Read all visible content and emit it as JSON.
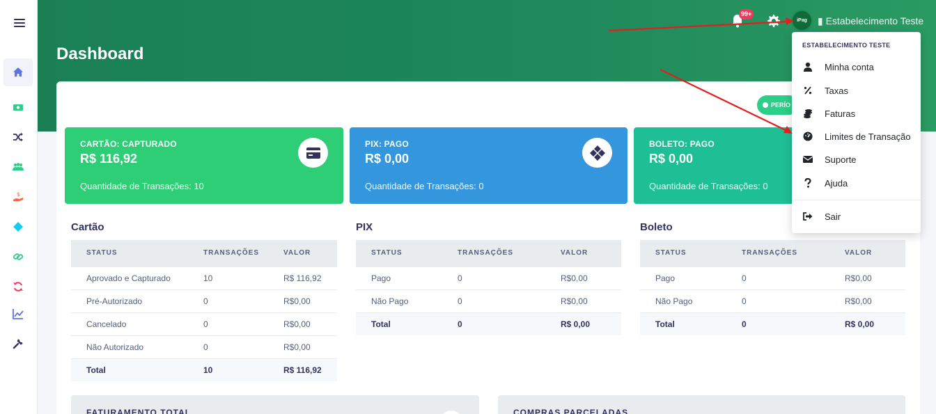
{
  "header": {
    "title": "Dashboard",
    "notification_badge": "99+",
    "avatar_text": "iPag",
    "store_name": "Estabelecimento Teste",
    "period_label": "PERÍO"
  },
  "sidebar": {
    "items": [
      {
        "icon": "home-icon",
        "color": "#5e72e4"
      },
      {
        "icon": "money-icon",
        "color": "#2dce89"
      },
      {
        "icon": "shuffle-icon",
        "color": "#32325d"
      },
      {
        "icon": "users-icon",
        "color": "#2dce89"
      },
      {
        "icon": "hand-dollar-icon",
        "color": "#fb6340"
      },
      {
        "icon": "pix-icon",
        "color": "#11cdef"
      },
      {
        "icon": "link-icon",
        "color": "#2dce89"
      },
      {
        "icon": "refresh-icon",
        "color": "#f5365c"
      },
      {
        "icon": "chart-line-icon",
        "color": "#5e72e4"
      },
      {
        "icon": "wrench-icon",
        "color": "#32325d"
      }
    ]
  },
  "stats": {
    "card": {
      "label": "CARTÃO: CAPTURADO",
      "value": "R$ 116,92",
      "count": "Quantidade de Transações: 10"
    },
    "pix": {
      "label": "PIX: PAGO",
      "value": "R$ 0,00",
      "count": "Quantidade de Transações: 0"
    },
    "boleto": {
      "label": "BOLETO: PAGO",
      "value": "R$ 0,00",
      "count": "Quantidade de Transações: 0"
    }
  },
  "tables": {
    "headers": [
      "STATUS",
      "TRANSAÇÕES",
      "VALOR"
    ],
    "cartao": {
      "title": "Cartão",
      "rows": [
        [
          "Aprovado e Capturado",
          "10",
          "R$ 116,92"
        ],
        [
          "Pré-Autorizado",
          "0",
          "R$0,00"
        ],
        [
          "Cancelado",
          "0",
          "R$0,00"
        ],
        [
          "Não Autorizado",
          "0",
          "R$0,00"
        ]
      ],
      "total": [
        "Total",
        "10",
        "R$ 116,92"
      ]
    },
    "pix": {
      "title": "PIX",
      "rows": [
        [
          "Pago",
          "0",
          "R$0,00"
        ],
        [
          "Não Pago",
          "0",
          "R$0,00"
        ]
      ],
      "total": [
        "Total",
        "0",
        "R$ 0,00"
      ]
    },
    "boleto": {
      "title": "Boleto",
      "rows": [
        [
          "Pago",
          "0",
          "R$0,00"
        ],
        [
          "Não Pago",
          "0",
          "R$0,00"
        ]
      ],
      "total": [
        "Total",
        "0",
        "R$ 0,00"
      ]
    }
  },
  "bottom": {
    "left_title": "FATURAMENTO TOTAL",
    "right_title": "COMPRAS PARCELADAS"
  },
  "dropdown": {
    "header": "ESTABELECIMENTO TESTE",
    "items": [
      {
        "label": "Minha conta",
        "icon": "user-icon"
      },
      {
        "label": "Taxas",
        "icon": "percent-icon"
      },
      {
        "label": "Faturas",
        "icon": "coins-icon"
      },
      {
        "label": "Limites de Transação",
        "icon": "gauge-icon"
      },
      {
        "label": "Suporte",
        "icon": "envelope-icon"
      },
      {
        "label": "Ajuda",
        "icon": "question-icon"
      }
    ],
    "logout": {
      "label": "Sair",
      "icon": "sign-out-icon"
    }
  },
  "colors": {
    "header_green": "#1f8a5b",
    "card_green": "#2dce75",
    "pix_blue": "#3496dc",
    "boleto_teal": "#1fbf96",
    "arrow_red": "#e02020"
  }
}
